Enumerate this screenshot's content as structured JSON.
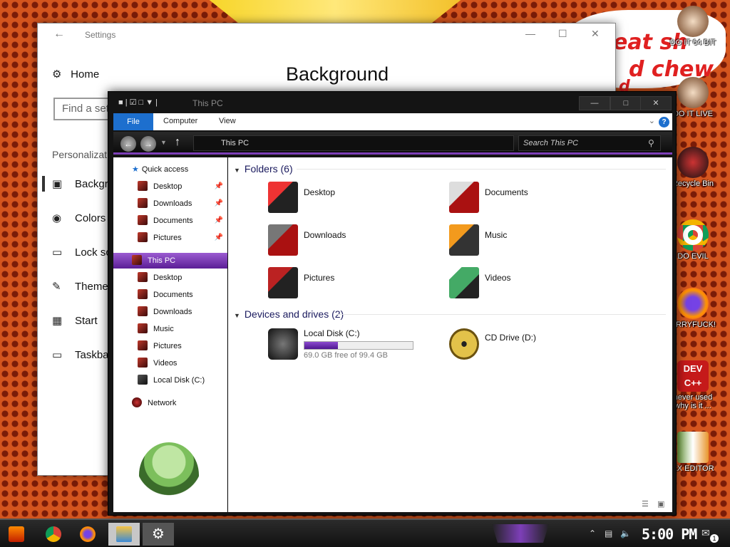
{
  "desktop": {
    "bubble_lines": [
      "eat sh",
      "d chew",
      "d"
    ],
    "icons": [
      {
        "label": "DO IT 64 BIT",
        "badge": "64"
      },
      {
        "label": "DO IT LIVE"
      },
      {
        "label": "Recycle Bin"
      },
      {
        "label": "DO EVIL"
      },
      {
        "label": "URRYFUCK!"
      },
      {
        "label": "never used why is it ...",
        "badge": "DEV C++"
      },
      {
        "label": "EX EDITOR"
      }
    ]
  },
  "settings": {
    "title": "Settings",
    "home": "Home",
    "search_placeholder": "Find a set",
    "section": "Personalizat",
    "heading": "Background",
    "nav": [
      "Backgro",
      "Colors",
      "Lock sc",
      "Theme",
      "Start",
      "Taskba"
    ]
  },
  "explorer": {
    "title": "This PC",
    "ribbon_tabs": [
      "File",
      "Computer",
      "View"
    ],
    "address": "This PC",
    "search_placeholder": "Search This PC",
    "nav": {
      "quick_access": "Quick access",
      "quick_items": [
        "Desktop",
        "Downloads",
        "Documents",
        "Pictures"
      ],
      "this_pc": "This PC",
      "pc_items": [
        "Desktop",
        "Documents",
        "Downloads",
        "Music",
        "Pictures",
        "Videos",
        "Local Disk (C:)"
      ],
      "network": "Network"
    },
    "folders_header": "Folders (6)",
    "folders": [
      "Desktop",
      "Documents",
      "Downloads",
      "Music",
      "Pictures",
      "Videos"
    ],
    "devices_header": "Devices and drives (2)",
    "drives": [
      {
        "name": "Local Disk (C:)",
        "free_text": "69.0 GB free of 99.4 GB",
        "used_fraction": 0.306
      },
      {
        "name": "CD Drive (D:)"
      }
    ]
  },
  "taskbar": {
    "clock": "5:00 PM",
    "notification_count": "1",
    "accent": "#7d3fb8"
  }
}
